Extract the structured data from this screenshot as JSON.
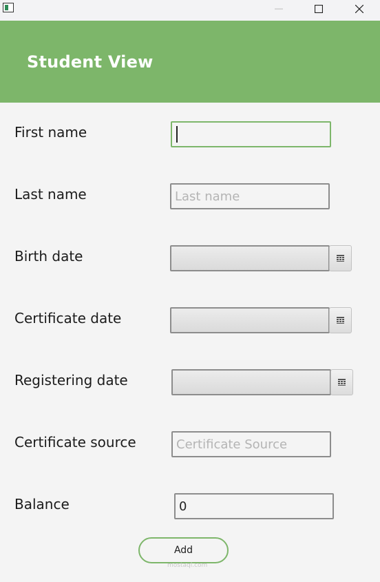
{
  "window": {
    "header_title": "Student View"
  },
  "form": {
    "first_name": {
      "label": "First name",
      "value": "",
      "placeholder": ""
    },
    "last_name": {
      "label": "Last name",
      "value": "",
      "placeholder": "Last name"
    },
    "birth_date": {
      "label": "Birth date",
      "value": ""
    },
    "certificate_date": {
      "label": "Certificate date",
      "value": ""
    },
    "registering_date": {
      "label": "Registering date",
      "value": ""
    },
    "certificate_source": {
      "label": "Certificate Source",
      "value": "",
      "placeholder": "Certificate Source",
      "display_label": "Certificate source"
    },
    "balance": {
      "label": "Balance",
      "value": "0"
    }
  },
  "actions": {
    "add_label": "Add"
  },
  "watermark": "mostaql.com",
  "colors": {
    "accent": "#7db66a",
    "header_text": "#ffffff",
    "border": "#8c8c8c",
    "placeholder": "#b4b4b4"
  },
  "icons": {
    "app": "app-window-icon",
    "minimize": "minimize-icon",
    "maximize": "maximize-icon",
    "close": "close-icon",
    "calendar": "calendar-icon"
  }
}
